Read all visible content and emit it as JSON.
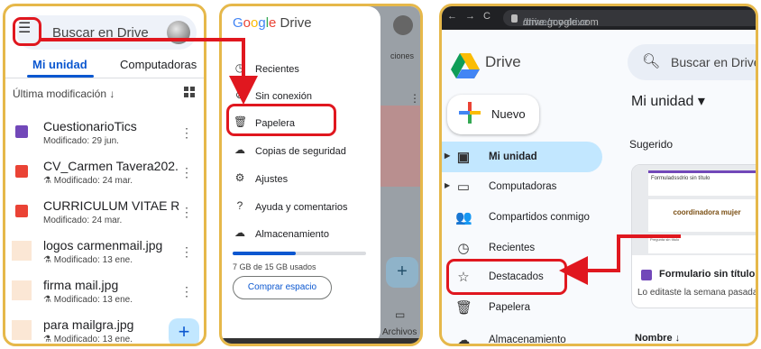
{
  "mobile_list": {
    "search_placeholder": "Buscar en Drive",
    "tabs": [
      "Mi unidad",
      "Computadoras"
    ],
    "sort_label": "Última modificación ↓",
    "files": [
      {
        "name": "CuestionarioTics",
        "meta": "Modificado: 29 jun.",
        "type": "forms"
      },
      {
        "name": "CV_Carmen Tavera202...",
        "meta": "⚗ Modificado: 24 mar.",
        "type": "pdf"
      },
      {
        "name": "CURRICULUM VITAE RE...",
        "meta": "Modificado: 24 mar.",
        "type": "pdf"
      },
      {
        "name": "logos carmenmail.jpg",
        "meta": "⚗ Modificado: 13 ene.",
        "type": "image"
      },
      {
        "name": "firma mail.jpg",
        "meta": "⚗ Modificado: 13 ene.",
        "type": "image"
      },
      {
        "name": "para mailgra.jpg",
        "meta": "⚗ Modificado: 13 ene.",
        "type": "image"
      }
    ],
    "fab": "+"
  },
  "mobile_drawer": {
    "brand": "Google Drive",
    "items": [
      {
        "label": "Recientes",
        "icon": "clock-icon",
        "glyph": "◷"
      },
      {
        "label": "Sin conexión",
        "icon": "offline-icon",
        "glyph": "⊘"
      },
      {
        "label": "Papelera",
        "icon": "trash-icon",
        "glyph": "🗑"
      },
      {
        "label": "Copias de seguridad",
        "icon": "backup-icon",
        "glyph": "☁"
      },
      {
        "label": "Ajustes",
        "icon": "gear-icon",
        "glyph": "⚙"
      },
      {
        "label": "Ayuda y comentarios",
        "icon": "help-icon",
        "glyph": "?"
      },
      {
        "label": "Almacenamiento",
        "icon": "cloud-icon",
        "glyph": "☁"
      }
    ],
    "storage_text": "7 GB de 15 GB usados",
    "storage_fraction": 0.47,
    "buy_button": "Comprar espacio",
    "behind": {
      "tab_fragment": "ciones",
      "files_label": "Archivos"
    }
  },
  "desktop": {
    "url_host": "drive.google.com",
    "url_path": "/drive/my-drive",
    "brand": "Drive",
    "search_placeholder": "Buscar en Drive",
    "new_button": "Nuevo",
    "nav": [
      {
        "label": "Mi unidad",
        "icon": "drive-icon",
        "glyph": "▣",
        "caret": true,
        "active": true
      },
      {
        "label": "Computadoras",
        "icon": "computer-icon",
        "glyph": "▭",
        "caret": true,
        "active": false
      },
      {
        "label": "Compartidos conmigo",
        "icon": "people-icon",
        "glyph": "👥",
        "caret": false,
        "active": false
      },
      {
        "label": "Recientes",
        "icon": "clock-icon",
        "glyph": "◷",
        "caret": false,
        "active": false
      },
      {
        "label": "Destacados",
        "icon": "star-icon",
        "glyph": "☆",
        "caret": false,
        "active": false
      },
      {
        "label": "Papelera",
        "icon": "trash-icon",
        "glyph": "🗑",
        "caret": false,
        "active": false
      },
      {
        "label": "Almacenamiento",
        "icon": "cloud-icon",
        "glyph": "☁",
        "caret": false,
        "active": false
      }
    ],
    "heading": "Mi unidad ▾",
    "suggested_label": "Sugerido",
    "card": {
      "thumb_title": "Formuladssdrio sin título",
      "thumb_logo": "coordinadora mujer",
      "thumb_question": "Pregunta sin título",
      "title": "Formulario sin título",
      "subtitle": "Lo editaste la semana pasada"
    },
    "name_column": "Nombre ↓"
  },
  "colors": {
    "panel_border": "#e6b84a",
    "highlight": "#e0171f",
    "accent": "#0b57d0"
  }
}
